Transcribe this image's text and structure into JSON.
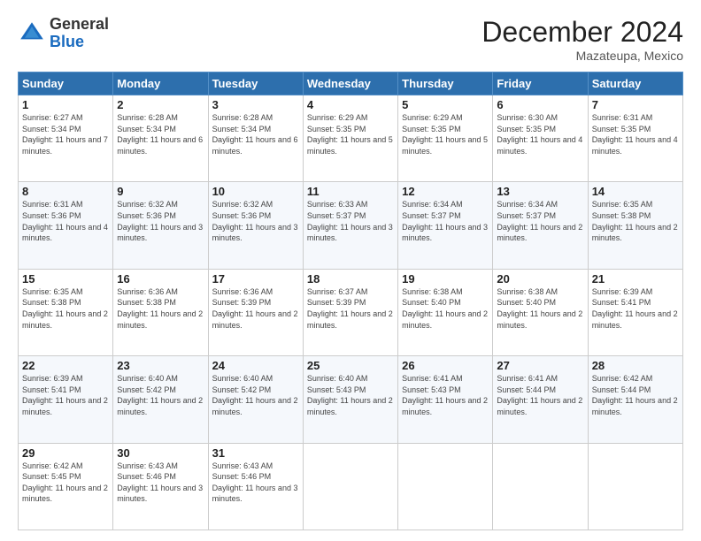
{
  "logo": {
    "general": "General",
    "blue": "Blue"
  },
  "header": {
    "month": "December 2024",
    "location": "Mazateupa, Mexico"
  },
  "weekdays": [
    "Sunday",
    "Monday",
    "Tuesday",
    "Wednesday",
    "Thursday",
    "Friday",
    "Saturday"
  ],
  "weeks": [
    [
      {
        "day": "1",
        "sunrise": "6:27 AM",
        "sunset": "5:34 PM",
        "daylight": "11 hours and 7 minutes."
      },
      {
        "day": "2",
        "sunrise": "6:28 AM",
        "sunset": "5:34 PM",
        "daylight": "11 hours and 6 minutes."
      },
      {
        "day": "3",
        "sunrise": "6:28 AM",
        "sunset": "5:34 PM",
        "daylight": "11 hours and 6 minutes."
      },
      {
        "day": "4",
        "sunrise": "6:29 AM",
        "sunset": "5:35 PM",
        "daylight": "11 hours and 5 minutes."
      },
      {
        "day": "5",
        "sunrise": "6:29 AM",
        "sunset": "5:35 PM",
        "daylight": "11 hours and 5 minutes."
      },
      {
        "day": "6",
        "sunrise": "6:30 AM",
        "sunset": "5:35 PM",
        "daylight": "11 hours and 4 minutes."
      },
      {
        "day": "7",
        "sunrise": "6:31 AM",
        "sunset": "5:35 PM",
        "daylight": "11 hours and 4 minutes."
      }
    ],
    [
      {
        "day": "8",
        "sunrise": "6:31 AM",
        "sunset": "5:36 PM",
        "daylight": "11 hours and 4 minutes."
      },
      {
        "day": "9",
        "sunrise": "6:32 AM",
        "sunset": "5:36 PM",
        "daylight": "11 hours and 3 minutes."
      },
      {
        "day": "10",
        "sunrise": "6:32 AM",
        "sunset": "5:36 PM",
        "daylight": "11 hours and 3 minutes."
      },
      {
        "day": "11",
        "sunrise": "6:33 AM",
        "sunset": "5:37 PM",
        "daylight": "11 hours and 3 minutes."
      },
      {
        "day": "12",
        "sunrise": "6:34 AM",
        "sunset": "5:37 PM",
        "daylight": "11 hours and 3 minutes."
      },
      {
        "day": "13",
        "sunrise": "6:34 AM",
        "sunset": "5:37 PM",
        "daylight": "11 hours and 2 minutes."
      },
      {
        "day": "14",
        "sunrise": "6:35 AM",
        "sunset": "5:38 PM",
        "daylight": "11 hours and 2 minutes."
      }
    ],
    [
      {
        "day": "15",
        "sunrise": "6:35 AM",
        "sunset": "5:38 PM",
        "daylight": "11 hours and 2 minutes."
      },
      {
        "day": "16",
        "sunrise": "6:36 AM",
        "sunset": "5:38 PM",
        "daylight": "11 hours and 2 minutes."
      },
      {
        "day": "17",
        "sunrise": "6:36 AM",
        "sunset": "5:39 PM",
        "daylight": "11 hours and 2 minutes."
      },
      {
        "day": "18",
        "sunrise": "6:37 AM",
        "sunset": "5:39 PM",
        "daylight": "11 hours and 2 minutes."
      },
      {
        "day": "19",
        "sunrise": "6:38 AM",
        "sunset": "5:40 PM",
        "daylight": "11 hours and 2 minutes."
      },
      {
        "day": "20",
        "sunrise": "6:38 AM",
        "sunset": "5:40 PM",
        "daylight": "11 hours and 2 minutes."
      },
      {
        "day": "21",
        "sunrise": "6:39 AM",
        "sunset": "5:41 PM",
        "daylight": "11 hours and 2 minutes."
      }
    ],
    [
      {
        "day": "22",
        "sunrise": "6:39 AM",
        "sunset": "5:41 PM",
        "daylight": "11 hours and 2 minutes."
      },
      {
        "day": "23",
        "sunrise": "6:40 AM",
        "sunset": "5:42 PM",
        "daylight": "11 hours and 2 minutes."
      },
      {
        "day": "24",
        "sunrise": "6:40 AM",
        "sunset": "5:42 PM",
        "daylight": "11 hours and 2 minutes."
      },
      {
        "day": "25",
        "sunrise": "6:40 AM",
        "sunset": "5:43 PM",
        "daylight": "11 hours and 2 minutes."
      },
      {
        "day": "26",
        "sunrise": "6:41 AM",
        "sunset": "5:43 PM",
        "daylight": "11 hours and 2 minutes."
      },
      {
        "day": "27",
        "sunrise": "6:41 AM",
        "sunset": "5:44 PM",
        "daylight": "11 hours and 2 minutes."
      },
      {
        "day": "28",
        "sunrise": "6:42 AM",
        "sunset": "5:44 PM",
        "daylight": "11 hours and 2 minutes."
      }
    ],
    [
      {
        "day": "29",
        "sunrise": "6:42 AM",
        "sunset": "5:45 PM",
        "daylight": "11 hours and 2 minutes."
      },
      {
        "day": "30",
        "sunrise": "6:43 AM",
        "sunset": "5:46 PM",
        "daylight": "11 hours and 3 minutes."
      },
      {
        "day": "31",
        "sunrise": "6:43 AM",
        "sunset": "5:46 PM",
        "daylight": "11 hours and 3 minutes."
      },
      null,
      null,
      null,
      null
    ]
  ]
}
